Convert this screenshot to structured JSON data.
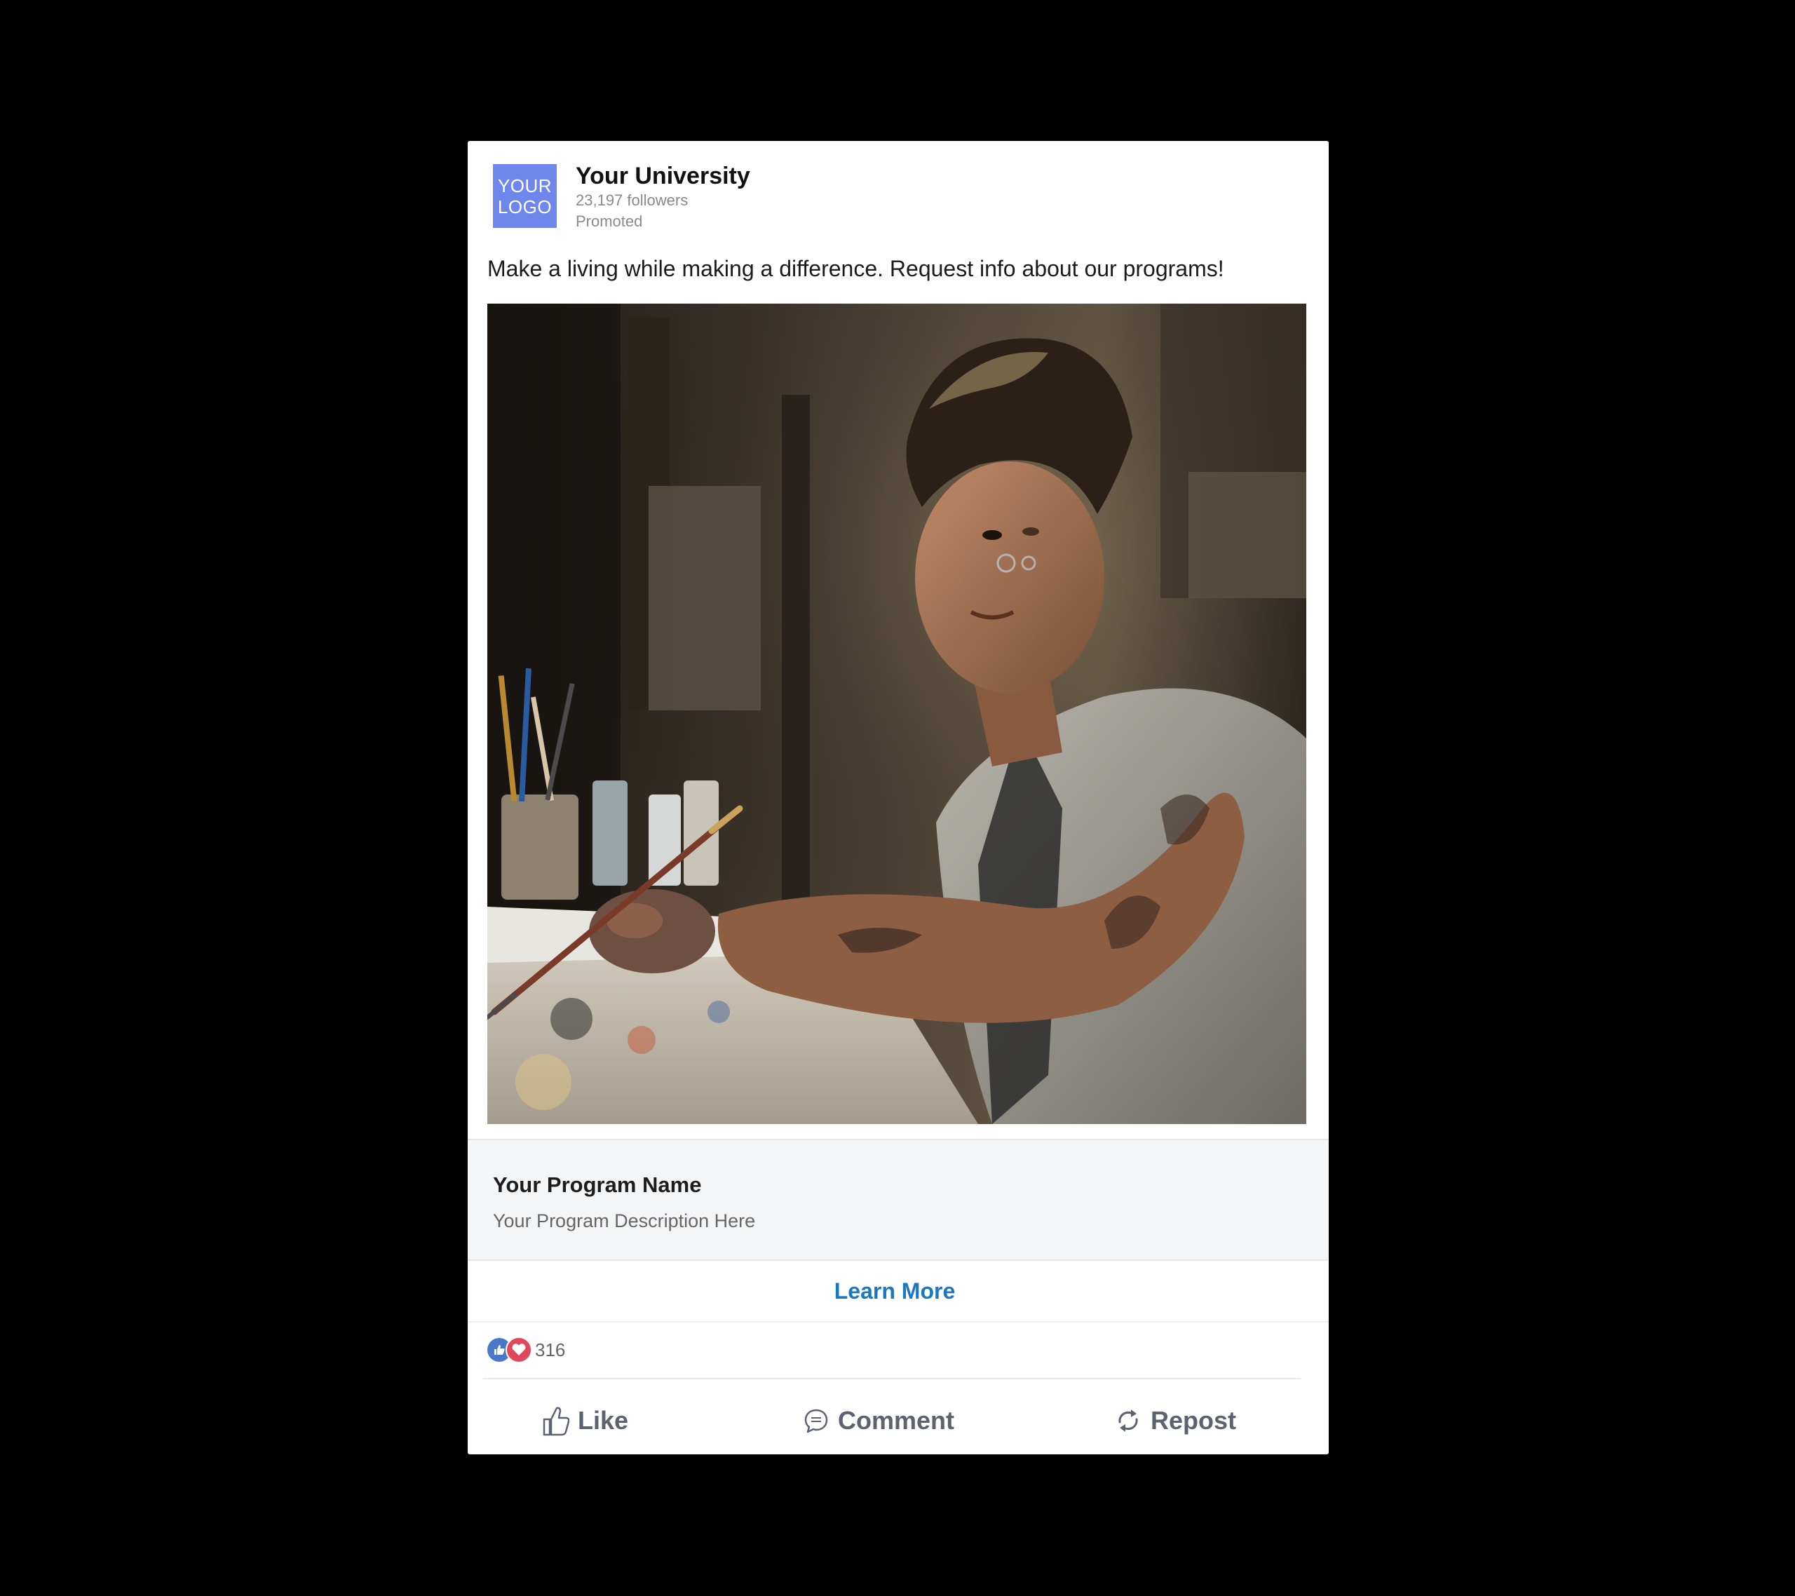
{
  "post": {
    "logo_line1": "YOUR",
    "logo_line2": "LOGO",
    "org_name": "Your University",
    "followers": "23,197 followers",
    "promoted": "Promoted",
    "text": "Make a living while making a difference. Request info about our programs!",
    "image_alt": "Artist painting at a studio table"
  },
  "program": {
    "name": "Your Program Name",
    "description": "Your Program Description Here"
  },
  "cta": {
    "label": "Learn More"
  },
  "reactions": {
    "count": "316",
    "icons": [
      "like-icon",
      "heart-icon"
    ]
  },
  "actions": {
    "like": "Like",
    "comment": "Comment",
    "repost": "Repost"
  },
  "colors": {
    "logo_bg": "#6f87ec",
    "cta": "#1a78c2",
    "like_reaction": "#4a78c8",
    "heart_reaction": "#e0475c",
    "page_bg": "#000000"
  }
}
